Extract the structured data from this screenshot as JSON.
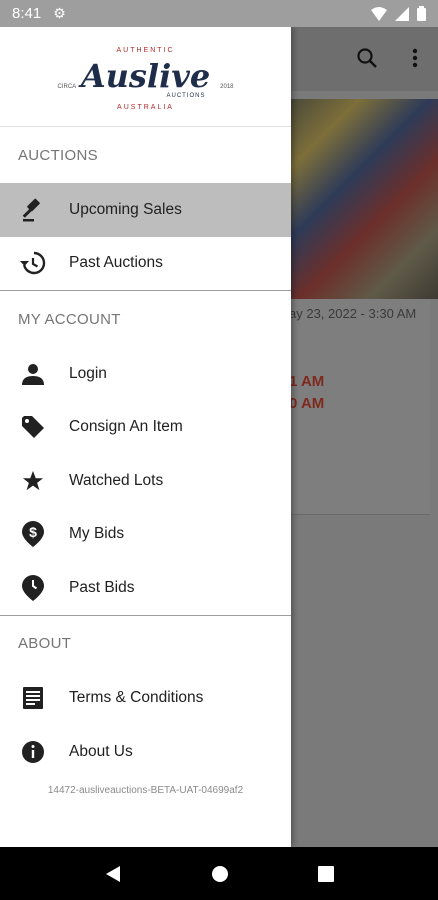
{
  "status_bar": {
    "time": "8:41"
  },
  "logo": {
    "top_text": "AUTHENTIC",
    "main_text": "Auslive",
    "sub_text": "AUCTIONS",
    "left_text": "CIRCA",
    "right_text": "2018",
    "bottom_text": "AUSTRALIA"
  },
  "drawer": {
    "sections": [
      {
        "header": "AUCTIONS",
        "items": [
          {
            "label": "Upcoming Sales",
            "icon": "gavel-icon"
          },
          {
            "label": "Past Auctions",
            "icon": "history-icon"
          }
        ]
      },
      {
        "header": "MY ACCOUNT",
        "items": [
          {
            "label": "Login",
            "icon": "person-icon"
          },
          {
            "label": "Consign An Item",
            "icon": "tag-icon"
          },
          {
            "label": "Watched Lots",
            "icon": "star-icon"
          },
          {
            "label": "My Bids",
            "icon": "dollar-pin-icon"
          },
          {
            "label": "Past Bids",
            "icon": "clock-pin-icon"
          }
        ]
      },
      {
        "header": "ABOUT",
        "items": [
          {
            "label": "Terms & Conditions",
            "icon": "document-icon"
          },
          {
            "label": "About Us",
            "icon": "info-icon"
          }
        ]
      }
    ],
    "version": "14472-ausliveauctions-BETA-UAT-04699af2"
  },
  "background": {
    "date_text": "ay 23, 2022 - 3:30 AM",
    "time1": "1 AM",
    "time2": "0 AM"
  },
  "colors": {
    "active_item_bg": "#bdbdbd",
    "brand_navy": "#1f2d4a",
    "brand_red": "#b22a2a"
  }
}
